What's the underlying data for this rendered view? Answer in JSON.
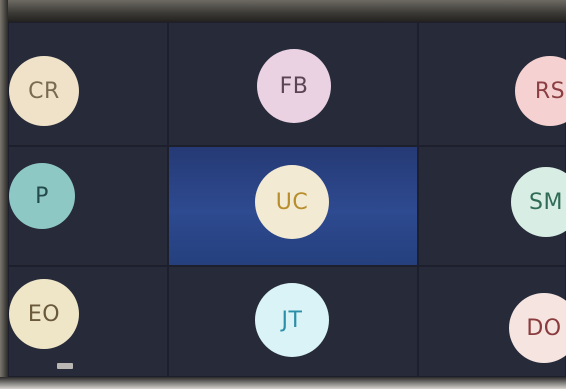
{
  "app": {
    "title": ""
  },
  "colors": {
    "cr": "#efe2c9",
    "fb": "#ead2e3",
    "rs": "#f5d2d1",
    "p": "#8ec8c5",
    "uc": "#f3ead3",
    "sm": "#d8ede4",
    "eo": "#efe6c7",
    "jt": "#d9f3f6",
    "do": "#f6e4e1"
  },
  "participants": [
    {
      "initials": "CR",
      "name": ""
    },
    {
      "initials": "FB",
      "name": ""
    },
    {
      "initials": "RS",
      "name": ""
    },
    {
      "initials": "P",
      "name": ""
    },
    {
      "initials": "UC",
      "name": ""
    },
    {
      "initials": "SM",
      "name": ""
    },
    {
      "initials": "EO",
      "name": ""
    },
    {
      "initials": "JT",
      "name": ""
    },
    {
      "initials": "DO",
      "name": ""
    }
  ]
}
